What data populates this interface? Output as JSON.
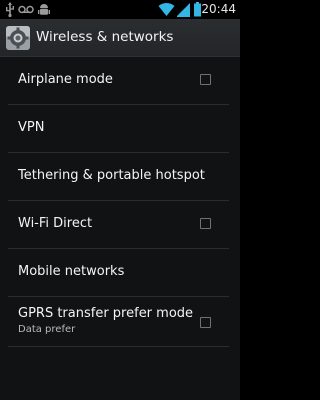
{
  "status_bar": {
    "time": "20:44",
    "icons": [
      "usb-icon",
      "voicemail-icon",
      "usb-debug-icon",
      "wifi-icon",
      "signal-icon",
      "battery-icon"
    ],
    "accent_color": "#33b5e5"
  },
  "action_bar": {
    "icon": "settings-app-icon",
    "title": "Wireless & networks"
  },
  "settings": [
    {
      "label": "Airplane mode",
      "has_checkbox": true,
      "checked": false
    },
    {
      "label": "VPN",
      "has_checkbox": false
    },
    {
      "label": "Tethering & portable hotspot",
      "has_checkbox": false
    },
    {
      "label": "Wi-Fi Direct",
      "has_checkbox": true,
      "checked": false
    },
    {
      "label": "Mobile networks",
      "has_checkbox": false
    },
    {
      "label": "GPRS transfer prefer mode",
      "summary": "Data prefer",
      "has_checkbox": true,
      "checked": false
    }
  ]
}
